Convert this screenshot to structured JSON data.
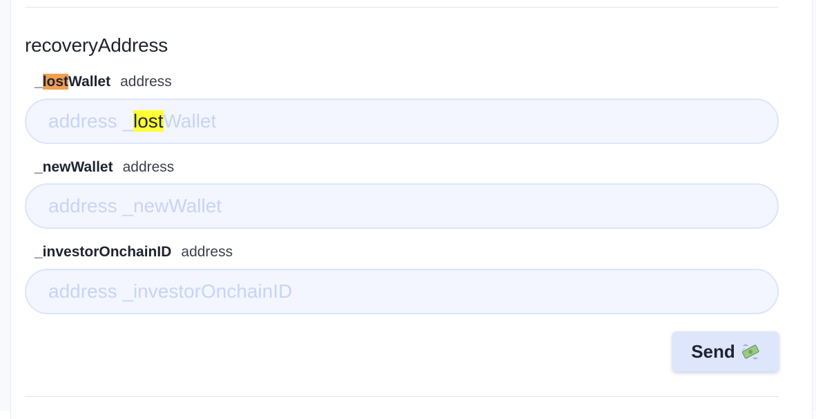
{
  "function": {
    "name": "recoveryAddress"
  },
  "params": [
    {
      "name_prefix": "_",
      "name_highlight": "lost",
      "name_suffix": "Wallet",
      "type": "address",
      "placeholder_prefix": "address _",
      "placeholder_highlight": "lost",
      "placeholder_suffix": "Wallet"
    },
    {
      "name": "_newWallet",
      "type": "address",
      "placeholder": "address _newWallet"
    },
    {
      "name": "_investorOnchainID",
      "type": "address",
      "placeholder": "address _investorOnchainID"
    }
  ],
  "send_button": {
    "label": "Send",
    "icon": "money-with-wings-icon"
  },
  "colors": {
    "search_highlight_label": "#f0a050",
    "search_highlight_input": "#ffff33",
    "input_background": "#f3f6fe",
    "input_border": "#dbe5fb",
    "button_background": "#dde6fa"
  }
}
